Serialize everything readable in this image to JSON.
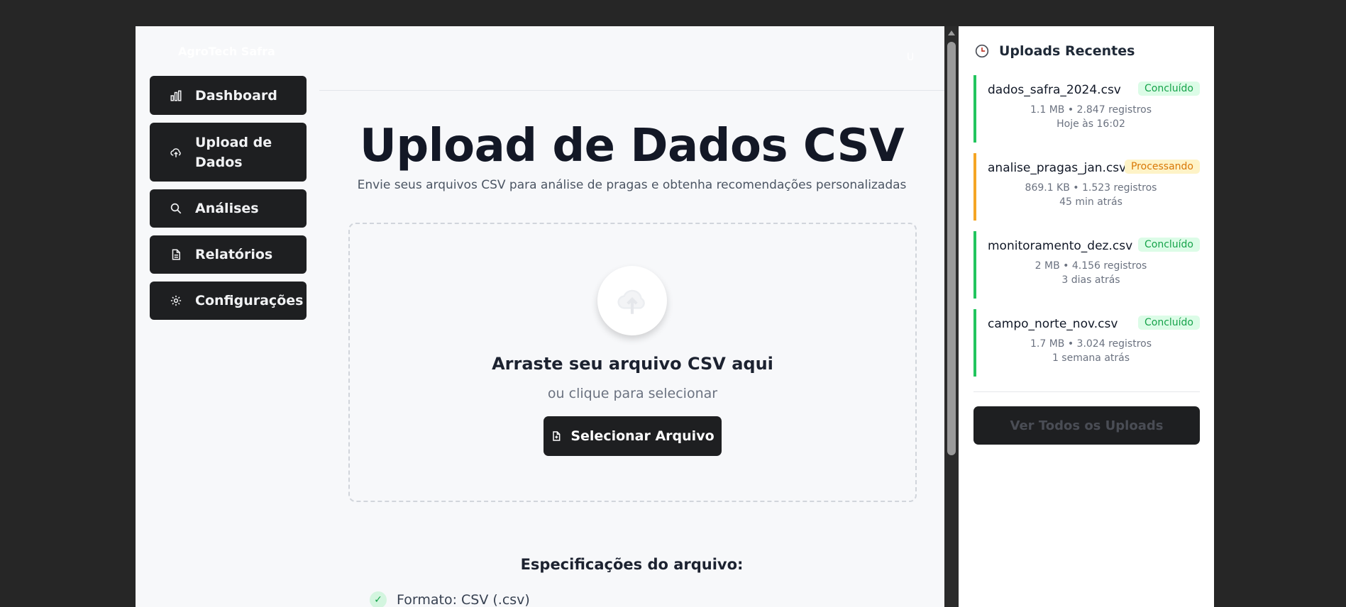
{
  "app": {
    "brand": "AgroTech Safra",
    "user_initial": "U"
  },
  "nav": {
    "items": [
      {
        "label": "Dashboard",
        "icon": "bar-chart-icon"
      },
      {
        "label": "Upload de Dados",
        "icon": "cloud-upload-icon"
      },
      {
        "label": "Análises",
        "icon": "search-icon"
      },
      {
        "label": "Relatórios",
        "icon": "document-icon"
      },
      {
        "label": "Configurações",
        "icon": "gear-icon"
      }
    ]
  },
  "main": {
    "title": "Upload de Dados CSV",
    "subtitle": "Envie seus arquivos CSV para análise de pragas e obtenha recomendações personalizadas",
    "dropzone": {
      "icon": "cloud-upload-icon",
      "title": "Arraste seu arquivo CSV aqui",
      "hint": "ou clique para selecionar",
      "button_label": "Selecionar Arquivo"
    },
    "specs": {
      "title": "Especificações do arquivo:",
      "items": [
        "Formato: CSV (.csv)"
      ]
    }
  },
  "recent": {
    "title": "Uploads Recentes",
    "icon": "clock-icon",
    "uploads": [
      {
        "name": "dados_safra_2024.csv",
        "status": "Concluído",
        "meta": "1.1 MB • 2.847 registros",
        "time": "Hoje às 16:02"
      },
      {
        "name": "analise_pragas_jan.csv",
        "status": "Processando",
        "meta": "869.1 KB • 1.523 registros",
        "time": "45 min atrás"
      },
      {
        "name": "monitoramento_dez.csv",
        "status": "Concluído",
        "meta": "2 MB • 4.156 registros",
        "time": "3 dias atrás"
      },
      {
        "name": "campo_norte_nov.csv",
        "status": "Concluído",
        "meta": "1.7 MB • 3.024 registros",
        "time": "1 semana atrás"
      }
    ],
    "view_all_label": "Ver Todos os Uploads"
  },
  "colors": {
    "accent_dark": "#1e1f21",
    "success": "#22c55e",
    "warning": "#f5a524",
    "title_text": "#131826"
  }
}
